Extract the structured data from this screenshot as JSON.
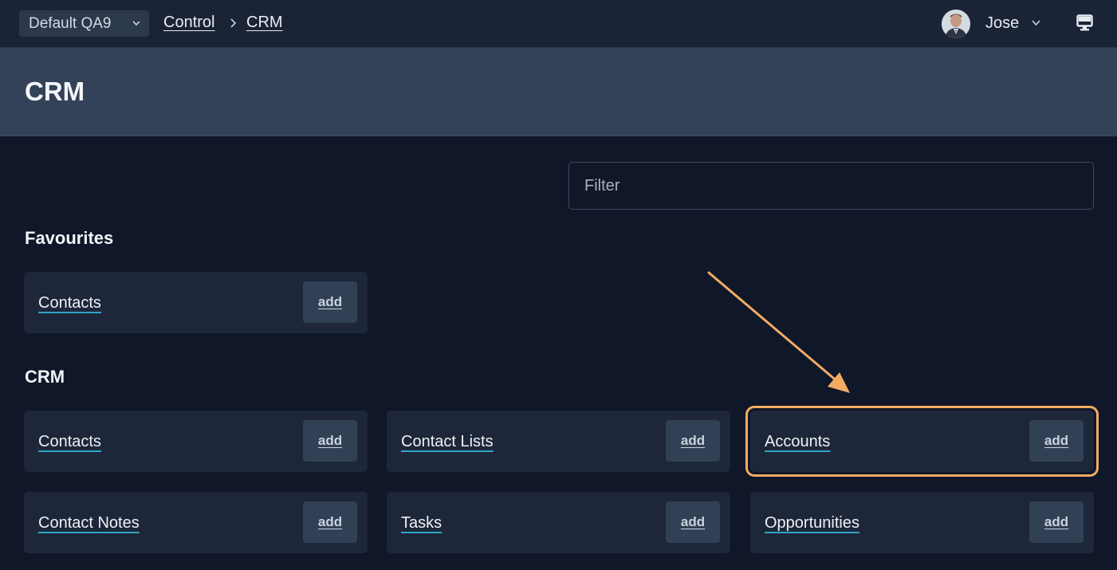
{
  "topbar": {
    "env_selector": "Default QA9",
    "breadcrumb": [
      "Control",
      "CRM"
    ],
    "user_name": "Jose",
    "icons": {
      "env_chevron": "chevron-down-icon",
      "breadcrumb_sep": "chevron-right-icon",
      "user_chevron": "chevron-down-icon",
      "display": "monitor-icon"
    }
  },
  "page": {
    "title": "CRM"
  },
  "filter": {
    "placeholder": "Filter"
  },
  "sections": {
    "favourites": {
      "title": "Favourites",
      "items": [
        {
          "label": "Contacts",
          "action": "add"
        }
      ]
    },
    "crm": {
      "title": "CRM",
      "items": [
        {
          "label": "Contacts",
          "action": "add"
        },
        {
          "label": "Contact Lists",
          "action": "add"
        },
        {
          "label": "Accounts",
          "action": "add",
          "highlighted": true
        },
        {
          "label": "Contact Notes",
          "action": "add"
        },
        {
          "label": "Tasks",
          "action": "add"
        },
        {
          "label": "Opportunities",
          "action": "add"
        }
      ]
    }
  },
  "colors": {
    "background": "#0f1729",
    "topbar": "#1b2436",
    "header_band": "#334258",
    "card": "#1d2739",
    "link_underline": "#2fa6c7",
    "highlight": "#f2ac62"
  }
}
